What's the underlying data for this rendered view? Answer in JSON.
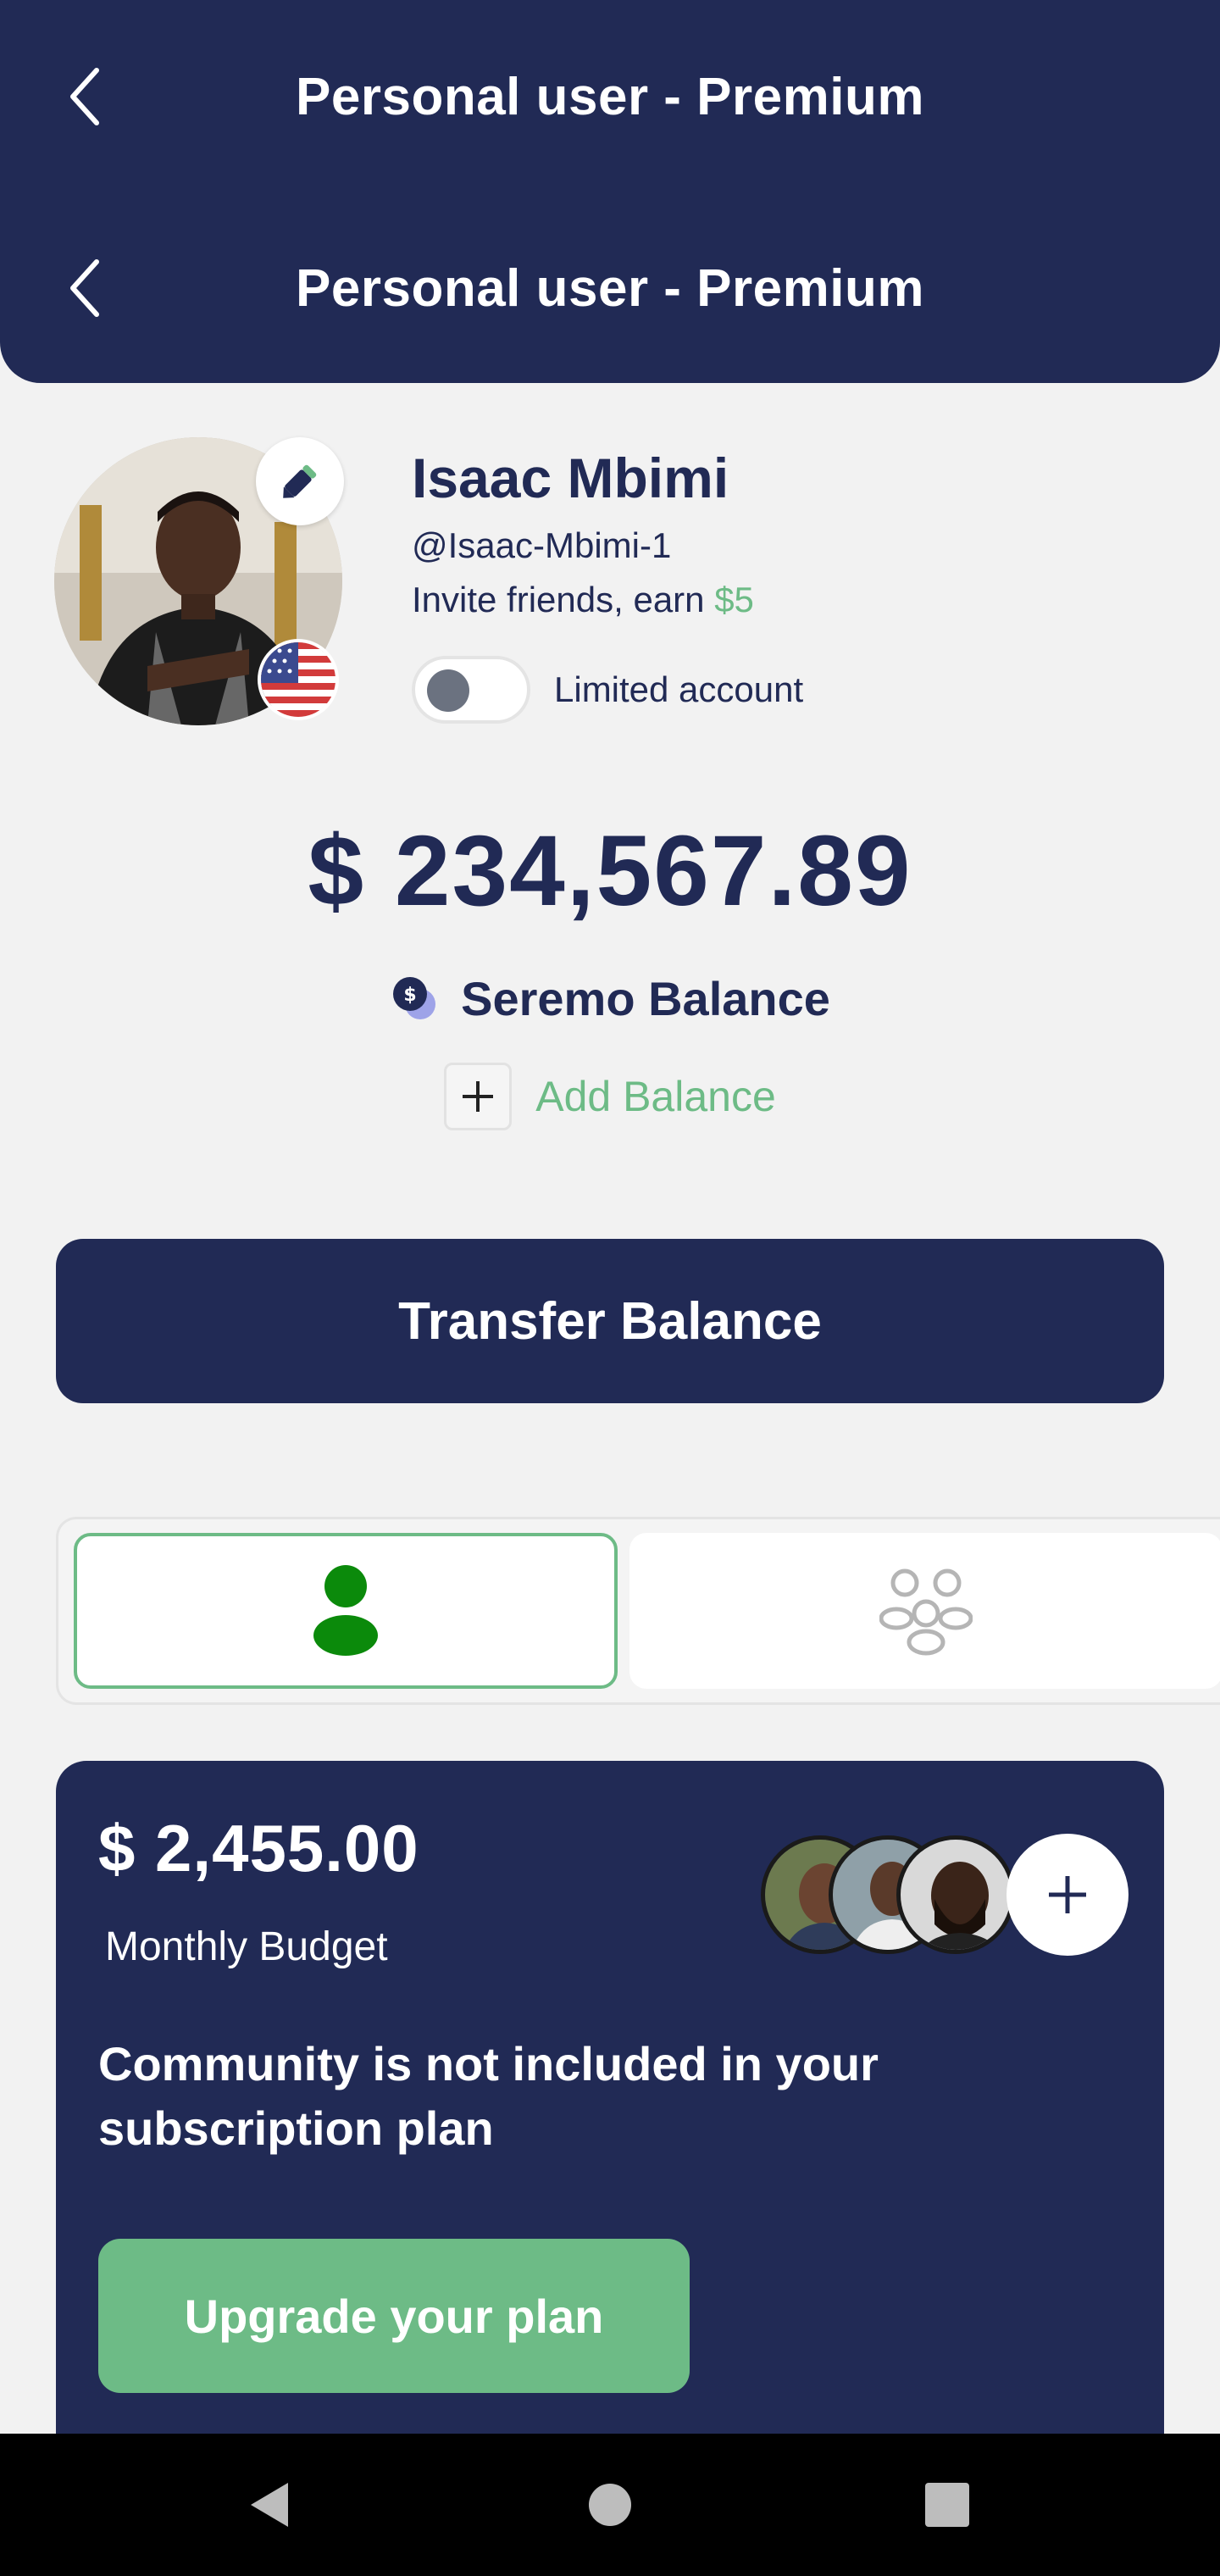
{
  "header": {
    "title_top": "Personal user - Premium",
    "title_main": "Personal user - Premium"
  },
  "profile": {
    "name": "Isaac Mbimi",
    "handle": "@Isaac-Mbimi-1",
    "invite_text": "Invite friends, earn ",
    "invite_amount": "$5",
    "limited_label": "Limited account",
    "limited_enabled": false,
    "flag_icon": "us-flag-icon"
  },
  "balance": {
    "amount": "$ 234,567.89",
    "label": "Seremo Balance",
    "add_label": "Add Balance"
  },
  "transfer": {
    "label": "Transfer Balance"
  },
  "tabs": [
    {
      "name": "personal",
      "icon": "single-user-icon",
      "active": true
    },
    {
      "name": "community",
      "icon": "group-users-icon",
      "active": false
    }
  ],
  "community_card": {
    "budget_amount": "$ 2,455.00",
    "budget_label": "Monthly Budget",
    "message": "Community is not included in your subscription plan",
    "upgrade_label": "Upgrade your plan"
  },
  "colors": {
    "navy": "#212a55",
    "green": "#6dbb86",
    "background": "#f2f2f2"
  }
}
